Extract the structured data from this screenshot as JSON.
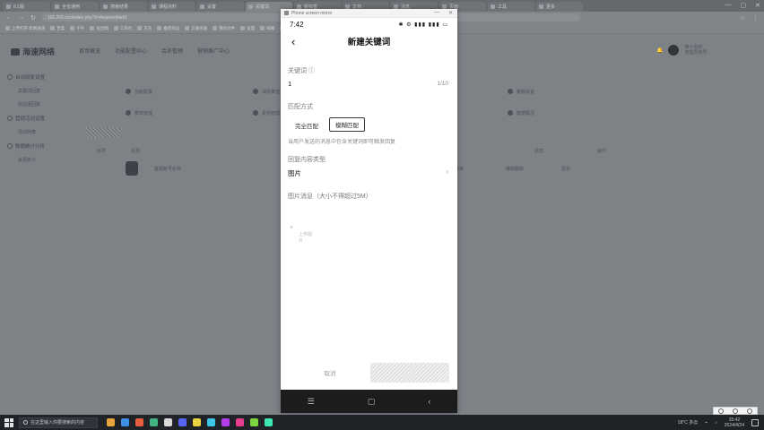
{
  "browser": {
    "tabs": [
      {
        "title": "8.1版"
      },
      {
        "title": "全省通用"
      },
      {
        "title": "搜索结果"
      },
      {
        "title": "课程资料"
      },
      {
        "title": "设置"
      },
      {
        "title": "关键词"
      },
      {
        "title": "新标签"
      },
      {
        "title": "文档"
      },
      {
        "title": "消息"
      },
      {
        "title": "页面"
      },
      {
        "title": "工具"
      },
      {
        "title": "更多"
      }
    ],
    "url": "101.200.xxx/index.php?s=/keyword/add",
    "bookmarks": [
      "上传打开 新闻速递",
      "百度",
      "千牛",
      "淘宝网",
      "工作台",
      "京东",
      "推荐商品",
      "云服务器",
      "我的文件",
      "设置",
      "邮箱",
      "地图",
      "商品管理",
      "网址导航",
      "翻译",
      "文档",
      "收藏夹"
    ]
  },
  "app": {
    "logo": "海速网络",
    "nav": [
      "首页概览",
      "功能配置中心",
      "会员管理",
      "营销推广中心"
    ],
    "user_line1": "用户名称",
    "user_line2": "管理员账号",
    "sidebar": [
      {
        "type": "grp",
        "label": "自动回复设置"
      },
      {
        "type": "sub",
        "label": "关键词回复"
      },
      {
        "type": "sub",
        "label": "欢迎语回复"
      },
      {
        "type": "grp",
        "label": "营销活动设置"
      },
      {
        "type": "sub",
        "label": "活动列表"
      },
      {
        "type": "grp",
        "label": "数据统计分析"
      },
      {
        "type": "sub",
        "label": "会员统计"
      }
    ],
    "cards": [
      [
        "功能配置",
        "消息推送",
        "关注回复",
        "客服设置"
      ],
      [
        "菜单管理",
        "素材管理",
        "会员卡券",
        "数据概况"
      ]
    ],
    "table_head": [
      "序号",
      "名称",
      "",
      "",
      "",
      "",
      "状态",
      "操作"
    ],
    "table_row": [
      "1",
      "客服账号名称",
      "",
      "",
      "已启用",
      "编辑删除",
      "更多"
    ]
  },
  "phone": {
    "window_title": "Phone screen mirror",
    "time": "7:42",
    "status_icons": "✱ ⚙ ▮▮▮ ▮▮▮ ▭",
    "page_title": "新建关键词",
    "keyword_label": "关键词 ⓘ",
    "keyword_value": "1",
    "keyword_count": "1/10",
    "match_label": "匹配方式",
    "match_options": [
      "完全匹配",
      "模糊匹配"
    ],
    "selected_match": "模糊匹配",
    "match_hint": "当用户发送的消息中包含关键词即可触发回复",
    "reply_type_label": "回复内容类型",
    "reply_type_value": "图片",
    "image_label": "图片消息（大小不得超过5M）",
    "upload_plus": "+",
    "upload_text": "上传图片",
    "cancel": "取消",
    "confirm": "确定",
    "nav": [
      "☰",
      "▢",
      "‹"
    ]
  },
  "taskbar": {
    "search_placeholder": "在这里输入你要搜索的内容",
    "weather": "18°C 多云",
    "time": "15:42",
    "date": "2024/4/24",
    "app_colors": [
      "#e8a33d",
      "#3d8fe8",
      "#e85d3d",
      "#43b581",
      "#d9d9d9",
      "#5865f2",
      "#e8d23d",
      "#3dc6e8",
      "#b33de8",
      "#e83d8f",
      "#7dd63d",
      "#3de8b3"
    ]
  }
}
